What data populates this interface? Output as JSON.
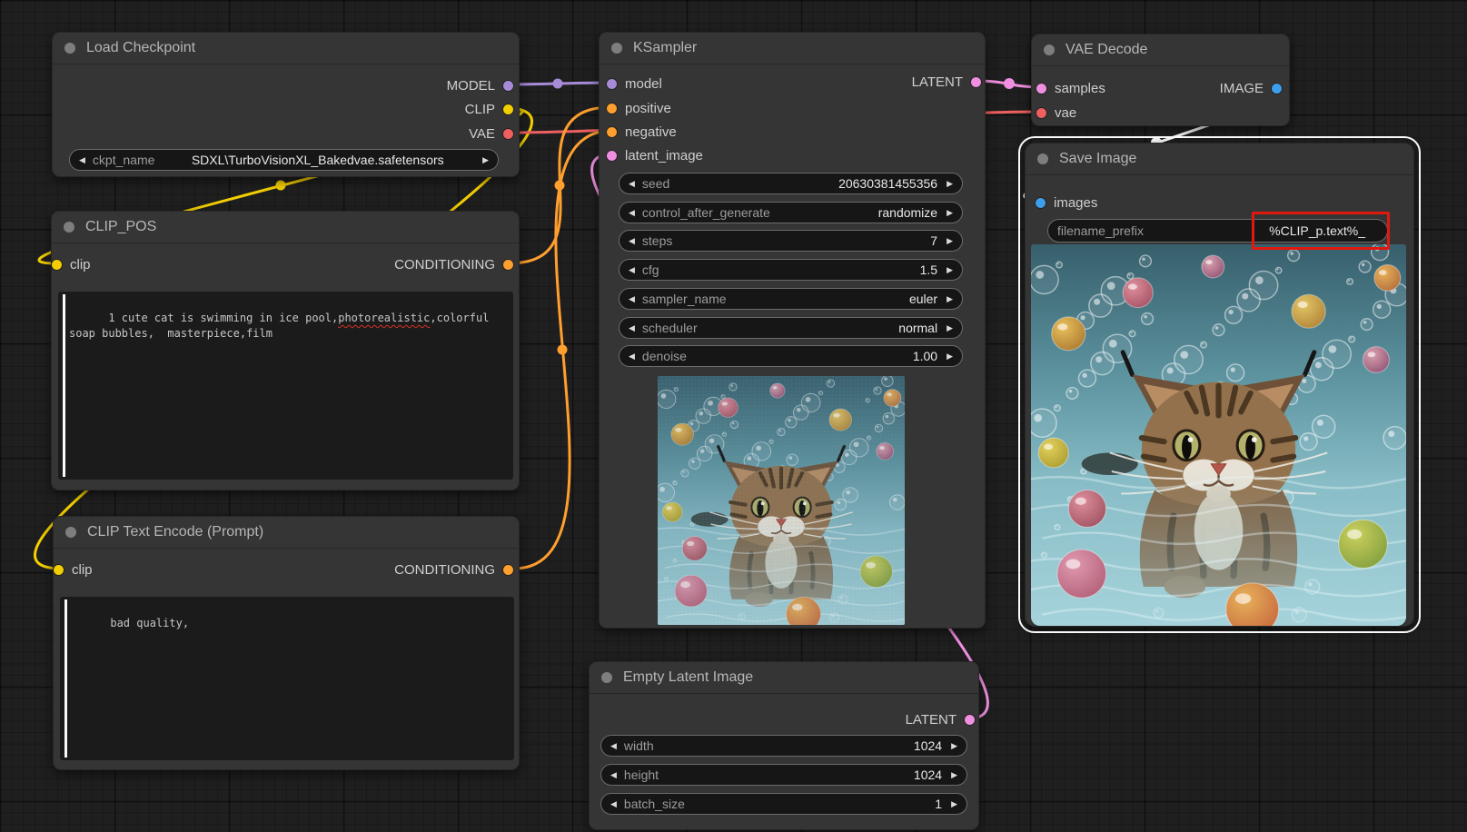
{
  "app": {
    "name": "ComfyUI node graph"
  },
  "colors": {
    "canvas_bg": "#1f1f1f",
    "node_bg": "#353535",
    "model": "#A78BD8",
    "clip": "#F2CE02",
    "vae": "#EE5F5F",
    "conditioning": "#FF9F2E",
    "latent": "#F08FE0",
    "image": "#3F9EEA",
    "image_link": "#FFFFFF",
    "annotation_red": "#E0190F",
    "selection_outline": "#FAFAFA"
  },
  "nodes": {
    "load_checkpoint": {
      "title": "Load Checkpoint",
      "outputs": [
        "MODEL",
        "CLIP",
        "VAE"
      ],
      "widget": {
        "label": "ckpt_name",
        "value": "SDXL\\TurboVisionXL_Bakedvae.safetensors"
      }
    },
    "clip_pos": {
      "title": "CLIP_POS",
      "input": "clip",
      "output": "CONDITIONING",
      "prompt_before": "1 cute cat is swimming in ice pool,",
      "prompt_misspelled": "photorealistic",
      "prompt_after": ",colorful soap bubbles,  masterpiece,film"
    },
    "clip_neg": {
      "title": "CLIP Text Encode (Prompt)",
      "input": "clip",
      "output": "CONDITIONING",
      "prompt": "bad quality,"
    },
    "ksampler": {
      "title": "KSampler",
      "inputs": [
        "model",
        "positive",
        "negative",
        "latent_image"
      ],
      "output": "LATENT",
      "widgets": [
        {
          "label": "seed",
          "value": "20630381455356"
        },
        {
          "label": "control_after_generate",
          "value": "randomize"
        },
        {
          "label": "steps",
          "value": "7"
        },
        {
          "label": "cfg",
          "value": "1.5"
        },
        {
          "label": "sampler_name",
          "value": "euler"
        },
        {
          "label": "scheduler",
          "value": "normal"
        },
        {
          "label": "denoise",
          "value": "1.00"
        }
      ]
    },
    "vae_decode": {
      "title": "VAE Decode",
      "inputs": [
        "samples",
        "vae"
      ],
      "output": "IMAGE"
    },
    "save_image": {
      "title": "Save Image",
      "input": "images",
      "widget": {
        "label": "filename_prefix",
        "value": "%CLIP_p.text%_"
      },
      "selected": true
    },
    "empty_latent": {
      "title": "Empty Latent Image",
      "output": "LATENT",
      "widgets": [
        {
          "label": "width",
          "value": "1024"
        },
        {
          "label": "height",
          "value": "1024"
        },
        {
          "label": "batch_size",
          "value": "1"
        }
      ]
    }
  }
}
